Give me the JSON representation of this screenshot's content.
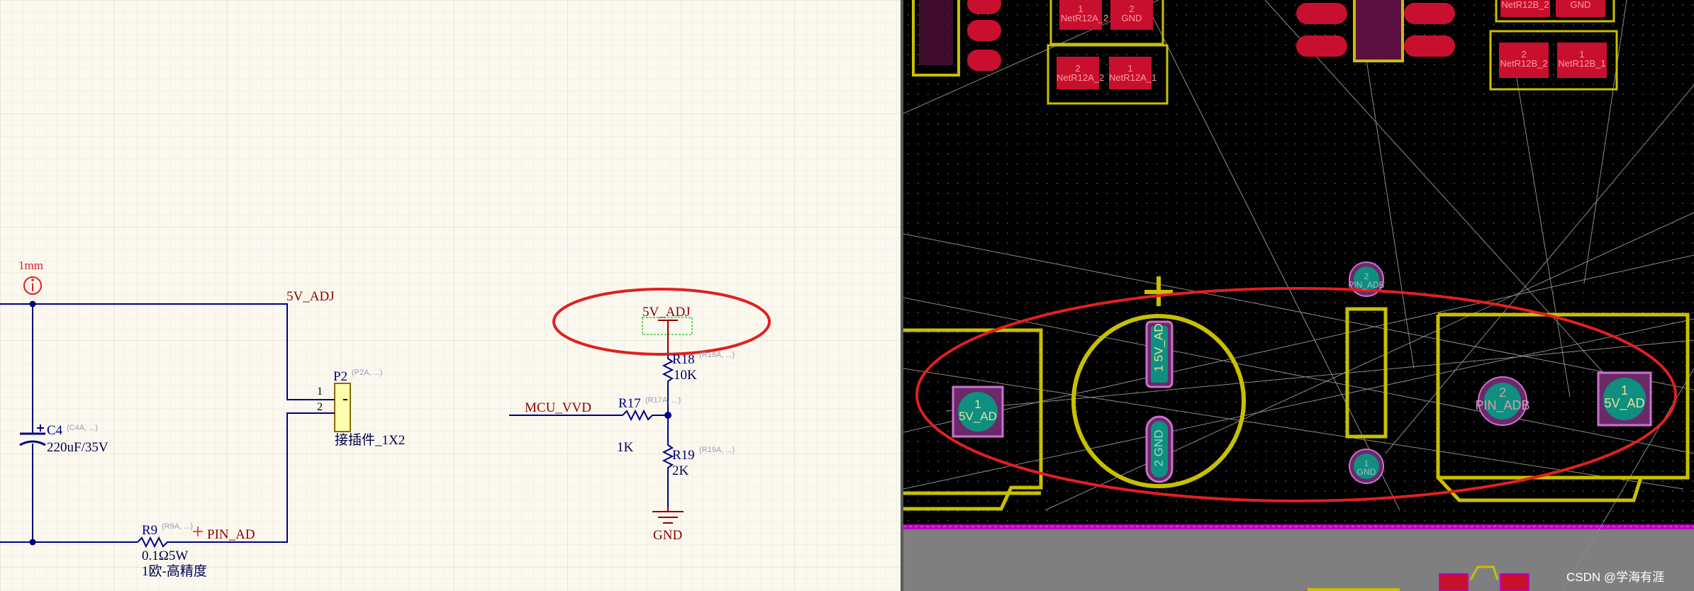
{
  "schematic": {
    "clearance_marker": {
      "label": "1mm",
      "icon": "info-circle-icon"
    },
    "net_labels": {
      "top_rail": "5V_ADJ",
      "power_port": "5V_ADJ",
      "mcu": "MCU_VVD",
      "pin_ad": "PIN_AD",
      "ground": "GND"
    },
    "components": {
      "c4": {
        "designator": "C4",
        "ref": "(C4A, ...)",
        "value": "220uF/35V"
      },
      "r9": {
        "designator": "R9",
        "ref": "(R9A, ...)",
        "value": "0.1Ω5W",
        "comment": "1欧-高精度"
      },
      "p2": {
        "designator": "P2",
        "ref": "(P2A, ...)",
        "value": "接插件_1X2",
        "pin1": "1",
        "pin2": "2"
      },
      "r18": {
        "designator": "R18",
        "ref": "(R18A, ...)",
        "value": "10K"
      },
      "r17": {
        "designator": "R17",
        "ref": "(R17A, ...)",
        "value": "1K"
      },
      "r19": {
        "designator": "R19",
        "ref": "(R19A, ...)",
        "value": "2K"
      }
    },
    "colors": {
      "wire": "#00007f",
      "net_label": "#8b0000",
      "highlight_ellipse": "#e02020",
      "background": "#fbf8ef"
    }
  },
  "pcb": {
    "pads": {
      "j_left": {
        "number": "1",
        "net": "5V_AD"
      },
      "cap_pos": {
        "number": "1",
        "net": "5V_AD"
      },
      "cap_neg": {
        "number": "2",
        "net": "GND"
      },
      "via_top": {
        "number": "2",
        "net": "PIN_ADB"
      },
      "via_bottom": {
        "number": "1",
        "net": "GND"
      },
      "conn_pin2": {
        "number": "2",
        "net": "PIN_ADB"
      },
      "conn_pin1": {
        "number": "1",
        "net": "5V_AD"
      }
    },
    "top_smd_pads": [
      {
        "number": "1",
        "net": "NetR12A_2"
      },
      {
        "number": "2",
        "net": "GND"
      },
      {
        "number": "2",
        "net": "NetR12A_2"
      },
      {
        "number": "1",
        "net": "NetR12A_1"
      },
      {
        "number": "",
        "net": "NetR12B_2"
      },
      {
        "number": "",
        "net": "GND"
      },
      {
        "number": "2",
        "net": "NetR12B_2"
      },
      {
        "number": "1",
        "net": "NetR12B_1"
      }
    ],
    "colors": {
      "silkscreen": "#c8c000",
      "pad": "#c8102e",
      "tht_pad": "#0f8f80",
      "board_edge": "#c000c0"
    }
  },
  "watermark": "CSDN @学海有涯"
}
